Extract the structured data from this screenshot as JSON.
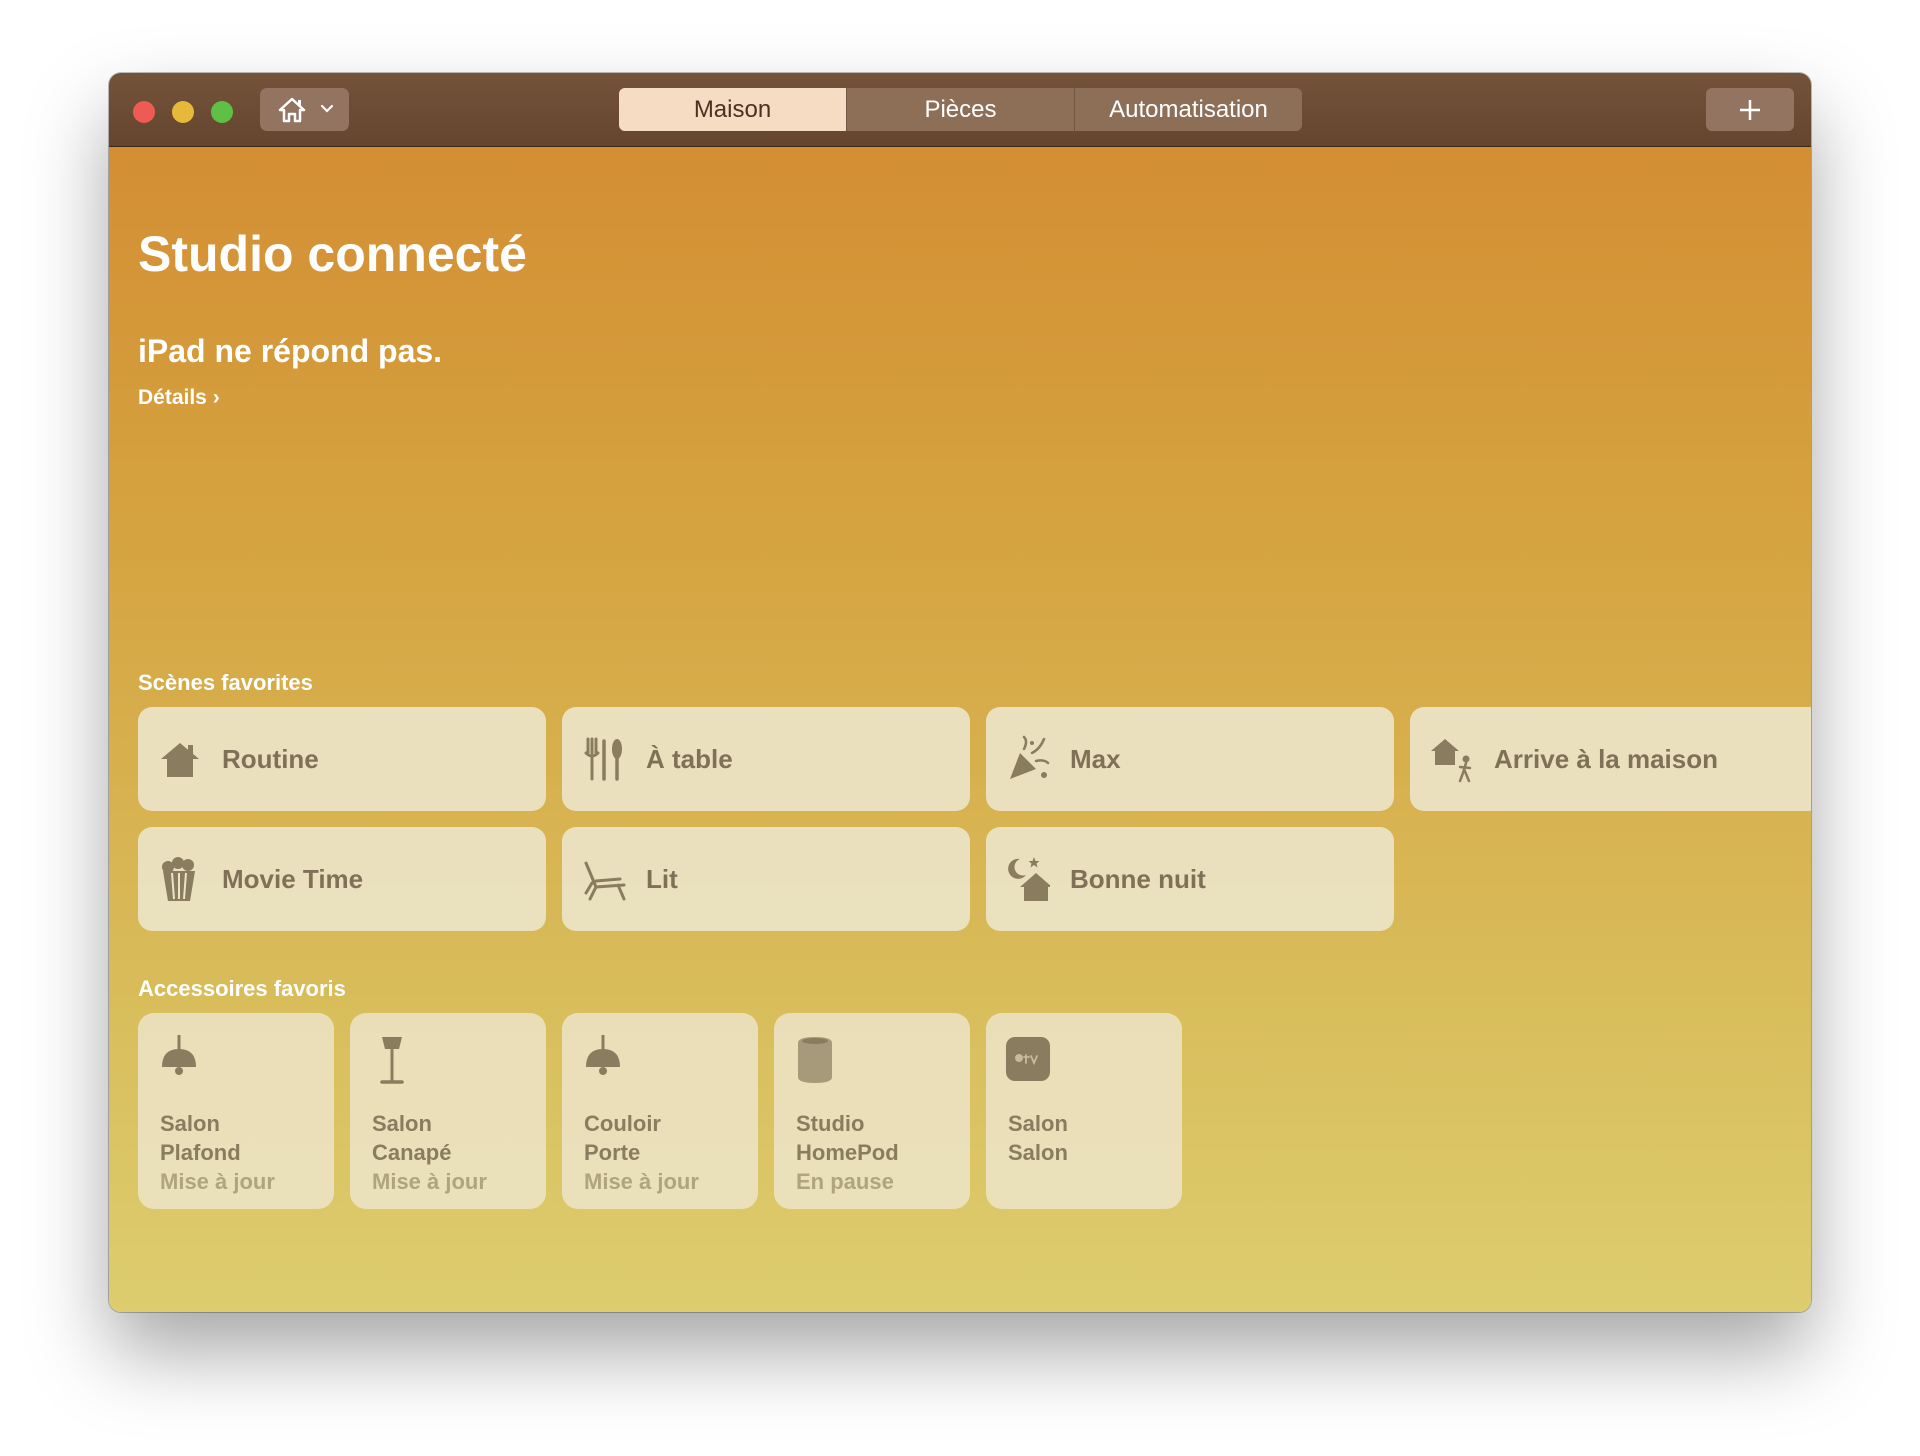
{
  "window": {
    "tabs": [
      "Maison",
      "Pièces",
      "Automatisation"
    ],
    "active_tab": "Maison"
  },
  "main": {
    "home_title": "Studio connecté",
    "alert_text": "iPad ne répond pas.",
    "details_link": "Détails ›"
  },
  "scenes": {
    "label": "Scènes favorites",
    "items": [
      {
        "label": "Routine",
        "icon": "house-icon"
      },
      {
        "label": "À table",
        "icon": "cutlery-icon"
      },
      {
        "label": "Max",
        "icon": "party-popper-icon"
      },
      {
        "label": "Arrive à la maison",
        "icon": "arrive-home-icon"
      },
      {
        "label": "Movie Time",
        "icon": "popcorn-icon"
      },
      {
        "label": "Lit",
        "icon": "lounge-chair-icon"
      },
      {
        "label": "Bonne nuit",
        "icon": "good-night-icon"
      }
    ]
  },
  "accessories": {
    "label": "Accessoires favoris",
    "items": [
      {
        "room": "Salon",
        "name": "Plafond",
        "status": "Mise à jour",
        "icon": "ceiling-lamp-icon"
      },
      {
        "room": "Salon",
        "name": "Canapé",
        "status": "Mise à jour",
        "icon": "floor-lamp-icon"
      },
      {
        "room": "Couloir",
        "name": "Porte",
        "status": "Mise à jour",
        "icon": "ceiling-lamp-icon"
      },
      {
        "room": "Studio",
        "name": "HomePod",
        "status": "En pause",
        "icon": "homepod-icon"
      },
      {
        "room": "Salon",
        "name": "Salon",
        "status": "",
        "icon": "apple-tv-icon"
      }
    ]
  },
  "colors": {
    "titlebar": "#6c4b33",
    "gradient_top": "#d38a31",
    "gradient_bottom": "#ddcd6f",
    "tile_icon": "#8a7c5f",
    "active_tab_bg": "#f6dcc3"
  }
}
